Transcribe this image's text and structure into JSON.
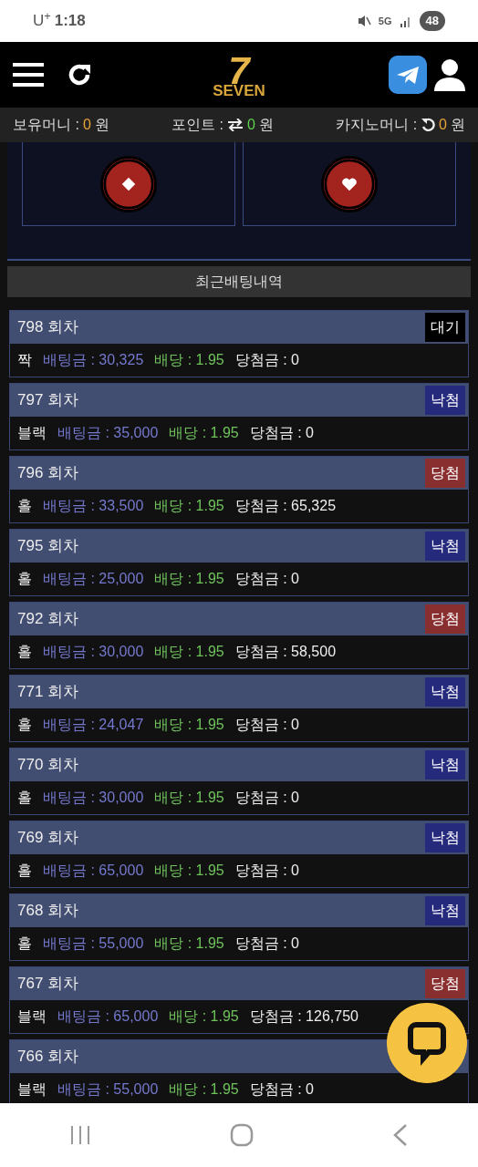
{
  "status_bar": {
    "carrier": "U$^{+}$",
    "time": "1:18",
    "network": "5G",
    "battery": "48"
  },
  "header": {
    "logo_mark": "7",
    "logo_text": "SEVEN"
  },
  "balances": [
    {
      "label": "보유머니 :",
      "kind": "plain",
      "value": "0",
      "color": "#e8a33a",
      "unit": "원"
    },
    {
      "label": "포인트 :",
      "kind": "exchange",
      "value": "0",
      "color": "#5fcf4f",
      "unit": "원"
    },
    {
      "label": "카지노머니 :",
      "kind": "refresh",
      "value": "0",
      "color": "#e8a33a",
      "unit": "원"
    }
  ],
  "bet_options": [
    {
      "kind": "diamond"
    },
    {
      "kind": "heart"
    }
  ],
  "history": {
    "title": "최근배팅내역",
    "rows": [
      {
        "round": "798 회차",
        "kind": "pending",
        "badge": "대기",
        "pick": "짝",
        "bet": "배팅금 : 30,325",
        "odds": "배당 : 1.95",
        "payout": "당첨금 : 0"
      },
      {
        "round": "797 회차",
        "kind": "lose",
        "badge": "낙첨",
        "pick": "블랙",
        "bet": "배팅금 : 35,000",
        "odds": "배당 : 1.95",
        "payout": "당첨금 : 0"
      },
      {
        "round": "796 회차",
        "kind": "win",
        "badge": "당첨",
        "pick": "홀",
        "bet": "배팅금 : 33,500",
        "odds": "배당 : 1.95",
        "payout": "당첨금 : 65,325"
      },
      {
        "round": "795 회차",
        "kind": "lose",
        "badge": "낙첨",
        "pick": "홀",
        "bet": "배팅금 : 25,000",
        "odds": "배당 : 1.95",
        "payout": "당첨금 : 0"
      },
      {
        "round": "792 회차",
        "kind": "win",
        "badge": "당첨",
        "pick": "홀",
        "bet": "배팅금 : 30,000",
        "odds": "배당 : 1.95",
        "payout": "당첨금 : 58,500"
      },
      {
        "round": "771 회차",
        "kind": "lose",
        "badge": "낙첨",
        "pick": "홀",
        "bet": "배팅금 : 24,047",
        "odds": "배당 : 1.95",
        "payout": "당첨금 : 0"
      },
      {
        "round": "770 회차",
        "kind": "lose",
        "badge": "낙첨",
        "pick": "홀",
        "bet": "배팅금 : 30,000",
        "odds": "배당 : 1.95",
        "payout": "당첨금 : 0"
      },
      {
        "round": "769 회차",
        "kind": "lose",
        "badge": "낙첨",
        "pick": "홀",
        "bet": "배팅금 : 65,000",
        "odds": "배당 : 1.95",
        "payout": "당첨금 : 0"
      },
      {
        "round": "768 회차",
        "kind": "lose",
        "badge": "낙첨",
        "pick": "홀",
        "bet": "배팅금 : 55,000",
        "odds": "배당 : 1.95",
        "payout": "당첨금 : 0"
      },
      {
        "round": "767 회차",
        "kind": "win",
        "badge": "당첨",
        "pick": "블랙",
        "bet": "배팅금 : 65,000",
        "odds": "배당 : 1.95",
        "payout": "당첨금 : 126,750"
      },
      {
        "round": "766 회차",
        "pick": "블랙",
        "bet": "배팅금 : 55,000",
        "odds": "배당 : 1.95",
        "payout": "당첨금 : 0"
      }
    ]
  }
}
